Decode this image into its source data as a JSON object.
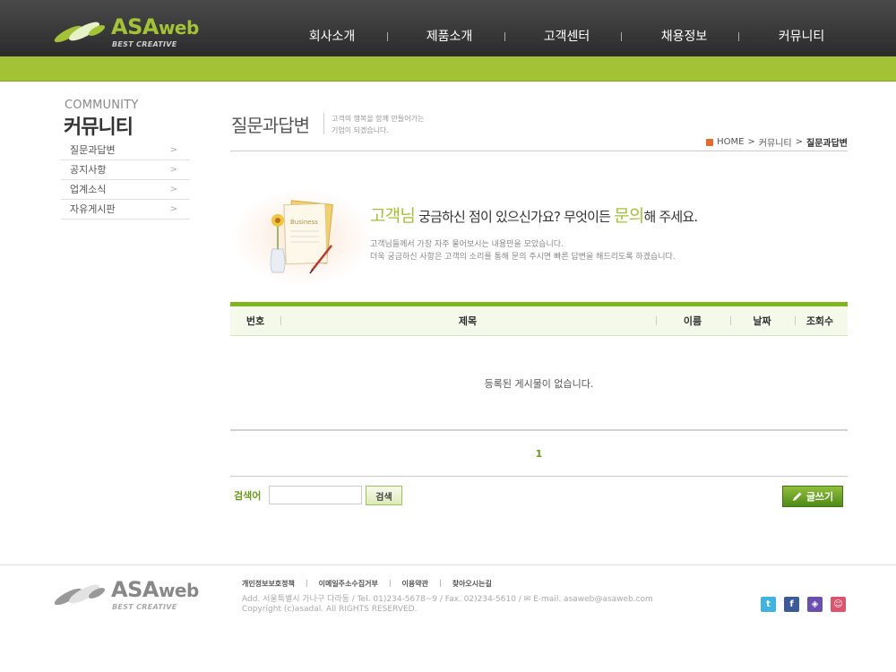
{
  "logo": {
    "main": "ASA",
    "suffix": "web",
    "sub": "BEST CREATIVE"
  },
  "gnb": [
    "회사소개",
    "제품소개",
    "고객센터",
    "채용정보",
    "커뮤니티"
  ],
  "lnb": {
    "title_en": "COMMUNITY",
    "title_ko": "커뮤니티",
    "items": [
      "질문과답변",
      "공지사항",
      "업계소식",
      "자유게시판"
    ],
    "arrow": ">"
  },
  "page": {
    "title": "질문과답변",
    "desc_line1": "고객의 행복을 함께 만들어가는",
    "desc_line2": "기업이 되겠습니다."
  },
  "breadcrumb": {
    "home": "HOME",
    "level1": "커뮤니티",
    "current": "질문과답변",
    "sep": ">"
  },
  "intro": {
    "hl1": "고객님",
    "text1": " 궁금하신 점이 있으신가요? 무엇이든 ",
    "hl2": "문의",
    "text2": "해 주세요.",
    "p1": "고객님들께서 가장 자주 물어보시는 내용만을 모았습니다.",
    "p2": "더욱 궁금하신 사항은 고객의 소리를 통해 문의 주시면 빠른 답변을 해드리도록 하겠습니다.",
    "img_label": "Business"
  },
  "board": {
    "columns": [
      "번호",
      "제목",
      "이름",
      "날짜",
      "조회수"
    ],
    "empty": "등록된 게시물이 없습니다.",
    "page": "1"
  },
  "search": {
    "label": "검색어",
    "value": "",
    "button": "검색"
  },
  "write_button": "글쓰기",
  "footer": {
    "links": [
      "개인정보보호정책",
      "이메일주소수집거부",
      "이용약관",
      "찾아오시는길"
    ],
    "address": "Add. 서울특별시 가나구 다라동 / Tel. 01)234-5678~9 / Fax. 02)234-5610 / ✉ E-mail. asaweb@asaweb.com",
    "copyright": "Copyright (c)asadal. All RIGHTS RESERVED."
  },
  "sns": [
    {
      "name": "twitter-icon",
      "glyph": "t",
      "color": "#3fb4e3"
    },
    {
      "name": "facebook-icon",
      "glyph": "f",
      "color": "#3b5a9a"
    },
    {
      "name": "foursquare-icon",
      "glyph": "◈",
      "color": "#6b4fb0"
    },
    {
      "name": "me2day-icon",
      "glyph": "☺",
      "color": "#e0526e"
    }
  ],
  "colors": {
    "accent": "#a4c236",
    "dark_green": "#6a9b1a",
    "header": "#3a3a3a"
  }
}
